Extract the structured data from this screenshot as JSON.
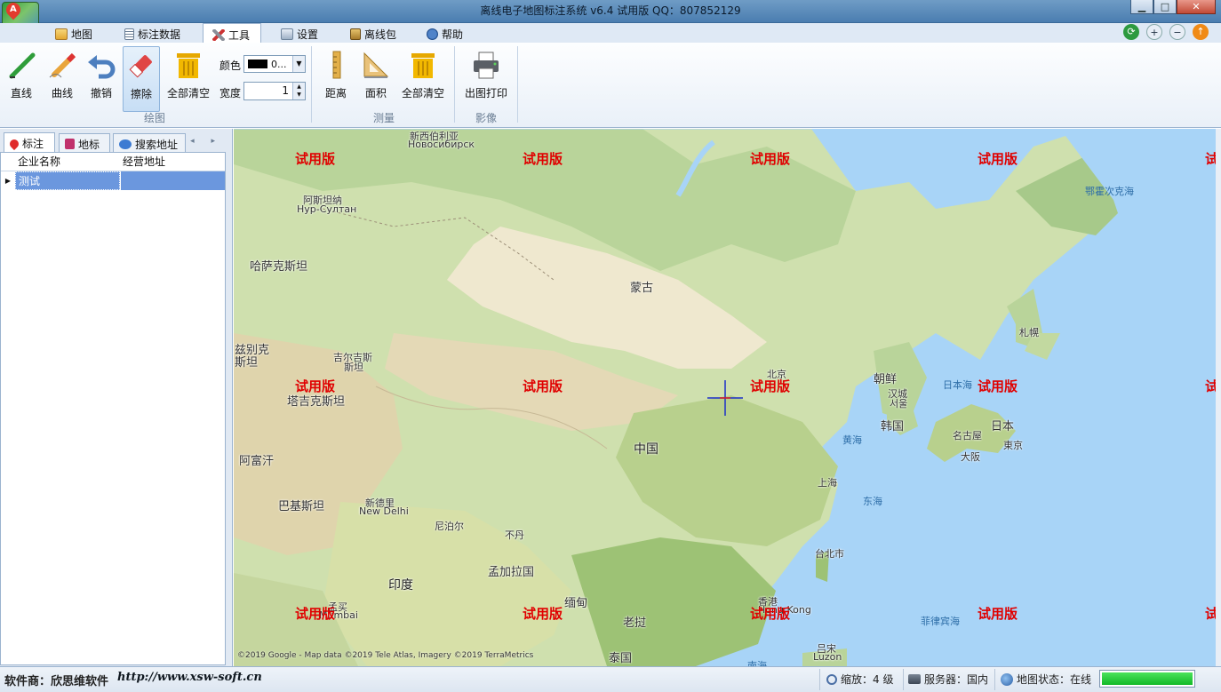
{
  "window": {
    "title": "离线电子地图标注系统 v6.4 试用版 QQ：807852129",
    "min_glyph": "▁",
    "max_glyph": "□",
    "close_glyph": "✕"
  },
  "tabs": [
    {
      "label": "地图",
      "icon": "map-icon"
    },
    {
      "label": "标注数据",
      "icon": "data-sheet-icon"
    },
    {
      "label": "工具",
      "icon": "tools-icon"
    },
    {
      "label": "设置",
      "icon": "settings-icon"
    },
    {
      "label": "离线包",
      "icon": "package-icon"
    },
    {
      "label": "帮助",
      "icon": "help-icon"
    }
  ],
  "active_tab": "工具",
  "ribbon": {
    "draw_group": {
      "label": "绘图",
      "buttons": [
        {
          "label": "直线",
          "icon": "line-pen-icon"
        },
        {
          "label": "曲线",
          "icon": "pencil-icon"
        },
        {
          "label": "撤销",
          "icon": "undo-icon"
        },
        {
          "label": "擦除",
          "icon": "eraser-icon"
        },
        {
          "label": "全部清空",
          "icon": "trash-bin-icon"
        }
      ],
      "color_label": "颜色",
      "color_value": "0...",
      "color_swatch": "#000000",
      "width_label": "宽度",
      "width_value": "1"
    },
    "measure_group": {
      "label": "测量",
      "buttons": [
        {
          "label": "距离",
          "icon": "ruler-icon"
        },
        {
          "label": "面积",
          "icon": "set-square-icon"
        },
        {
          "label": "全部清空",
          "icon": "trash-bin-icon"
        }
      ]
    },
    "image_group": {
      "label": "影像",
      "buttons": [
        {
          "label": "出图打印",
          "icon": "printer-icon"
        }
      ]
    }
  },
  "panel": {
    "tabs": [
      {
        "label": "标注",
        "icon": "marker-pin-icon"
      },
      {
        "label": "地标",
        "icon": "landmark-book-icon"
      },
      {
        "label": "搜索地址",
        "icon": "search-bubble-icon"
      }
    ],
    "arrows": "◂ ▸",
    "columns": [
      "企业名称",
      "经营地址"
    ],
    "rows": [
      {
        "name": "测试",
        "address": ""
      }
    ]
  },
  "map": {
    "watermark": "试用版",
    "labels": {
      "novosibirsk_cn": "新西伯利亚",
      "novosibirsk_ru": "Новосибирск",
      "astana_cn": "阿斯坦纳",
      "astana_ru": "Нур-Султан",
      "kazakhstan": "哈萨克斯坦",
      "uzbek1": "兹别克",
      "uzbek2": "斯坦",
      "kyrgyz1": "吉尔吉斯",
      "kyrgyz2": "斯坦",
      "tajik": "塔吉克斯坦",
      "afghan": "阿富汗",
      "pakistan": "巴基斯坦",
      "delhi_cn": "新德里",
      "delhi_en": "New Delhi",
      "nepal": "尼泊尔",
      "bhutan": "不丹",
      "bangladesh": "孟加拉国",
      "india": "印度",
      "mumbai_cn": "孟买",
      "mumbai_en": "Mumbai",
      "myanmar": "缅甸",
      "laos": "老挝",
      "thailand": "泰国",
      "mongolia": "蒙古",
      "china": "中国",
      "beijing": "北京",
      "shanghai": "上海",
      "hongkong_cn": "香港",
      "hongkong_en": "Hong Kong",
      "taipei": "台北市",
      "luzon_cn": "吕宋",
      "luzon_en": "Luzon",
      "south_china_sea": "南海",
      "nkorea": "朝鲜",
      "seoul1": "汉城",
      "seoul2": "서울",
      "skorea": "韩国",
      "yellow_sea": "黄海",
      "east_sea": "东海",
      "sea_of_japan": "日本海",
      "japan": "日本",
      "tokyo": "東京",
      "nagoya": "名古屋",
      "osaka": "大阪",
      "sapporo": "札幌",
      "okhotsk": "鄂霍次克海",
      "philippine_sea": "菲律宾海"
    },
    "copyright": "©2019 Google - Map data ©2019 Tele Atlas, Imagery ©2019 TerraMetrics"
  },
  "status": {
    "vendor": "软件商：欣思维软件",
    "url": "http://www.xsw-soft.cn",
    "zoom": "缩放：4 级",
    "server": "服务器：国内",
    "map_state": "地图状态：在线",
    "progress": 1.0
  }
}
